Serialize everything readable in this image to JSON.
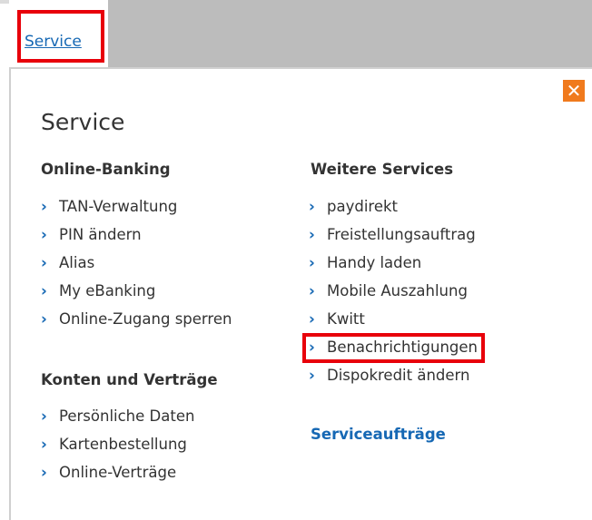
{
  "tab": {
    "label": "Service"
  },
  "panel": {
    "title": "Service",
    "close_glyph": "✕",
    "left": {
      "online_banking_heading": "Online-Banking",
      "online_banking_items": [
        "TAN-Verwaltung",
        "PIN ändern",
        "Alias",
        "My eBanking",
        "Online-Zugang sperren"
      ],
      "konten_heading": "Konten und Verträge",
      "konten_items": [
        "Persönliche Daten",
        "Kartenbestellung",
        "Online-Verträge"
      ]
    },
    "right": {
      "weitere_heading": "Weitere Services",
      "weitere_items": [
        "paydirekt",
        "Freistellungsauftrag",
        "Handy laden",
        "Mobile Auszahlung",
        "Kwitt",
        "Benachrichtigungen",
        "Dispokredit ändern"
      ],
      "serviceauftraege": "Serviceaufträge"
    }
  },
  "colors": {
    "accent": "#1668b4",
    "highlight": "#e8000a",
    "close": "#f07a1d"
  },
  "chevron": "›"
}
